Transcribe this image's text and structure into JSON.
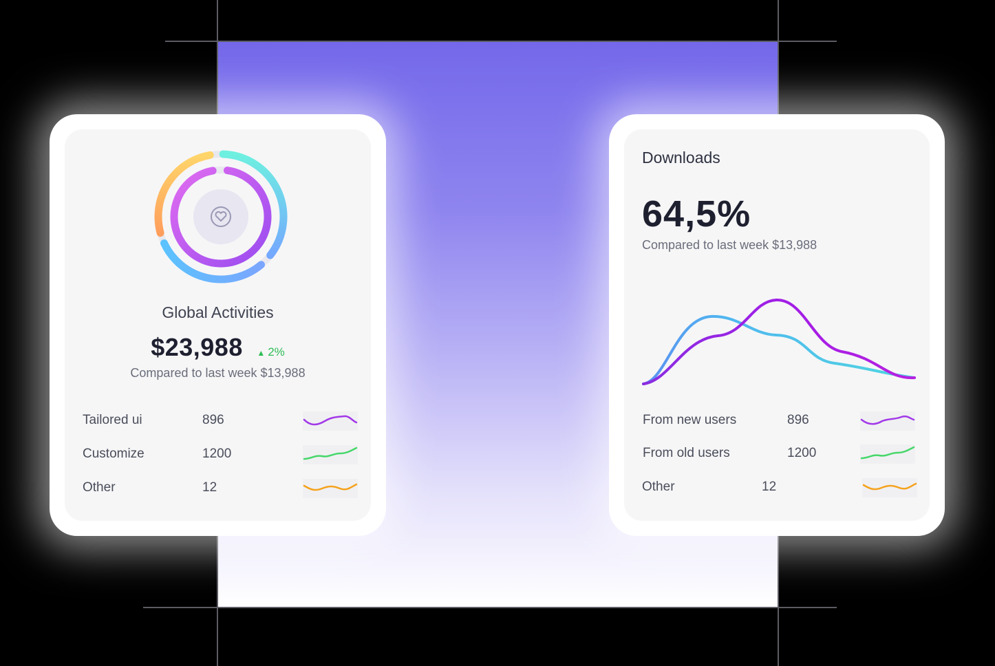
{
  "global_card": {
    "title": "Global Activities",
    "value": "$23,988",
    "delta": "2%",
    "delta_icon": "up-triangle-icon",
    "compare_text": "Compared to last week $13,988",
    "center_icon": "heart-icon",
    "rows": [
      {
        "label": "Tailored ui",
        "value": "896",
        "spark_color": "#a238e8"
      },
      {
        "label": "Customize",
        "value": "1200",
        "spark_color": "#46d76a"
      },
      {
        "label": "Other",
        "value": "12",
        "spark_color": "#f5a21c"
      }
    ]
  },
  "downloads_card": {
    "title": "Downloads",
    "value": "64,5%",
    "compare_text": "Compared to last week $13,988",
    "series_colors": [
      "#a11ee6",
      "#4fc9e8"
    ],
    "rows": [
      {
        "label": "From new users",
        "value": "896",
        "spark_color": "#a238e8"
      },
      {
        "label": "From old users",
        "value": "1200",
        "spark_color": "#46d76a"
      },
      {
        "label": "Other",
        "value": "12",
        "spark_color": "#f5a21c"
      }
    ]
  },
  "colors": {
    "accent_purple": "#7468ea",
    "positive": "#2dbd55"
  }
}
